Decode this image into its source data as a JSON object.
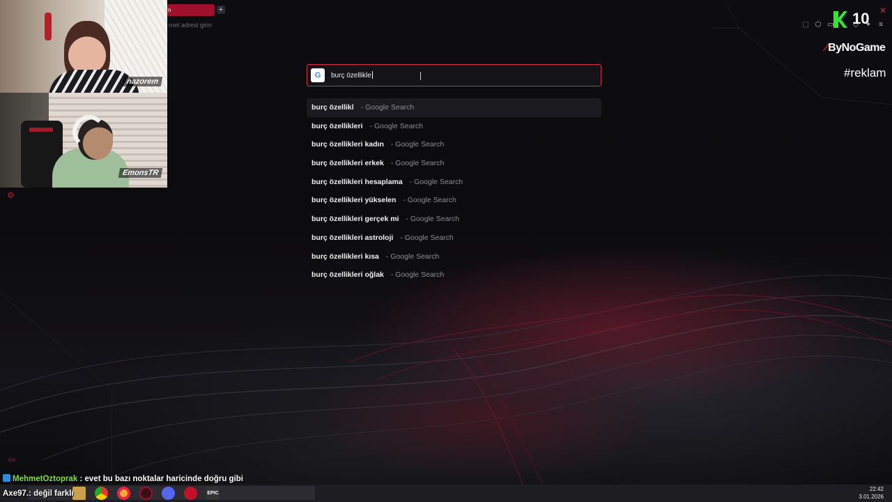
{
  "browser": {
    "active_tab_label": "n",
    "new_tab_label": "+",
    "address_hint": "rnet adresi girin",
    "close_glyph": "✕"
  },
  "webcams": {
    "top_name": "nazorem",
    "bottom_name": "EmonsTR"
  },
  "overlay": {
    "k_count": "10",
    "brand": "ByNoGame",
    "tag": "#reklam"
  },
  "search": {
    "query": "burç özellikle",
    "engine_icon": "G"
  },
  "suggestions": [
    {
      "query": "burç özellikl",
      "source": "- Google Search"
    },
    {
      "query": "burç özellikleri",
      "source": "- Google Search"
    },
    {
      "query": "burç özellikleri kadın",
      "source": "- Google Search"
    },
    {
      "query": "burç özellikleri erkek",
      "source": "- Google Search"
    },
    {
      "query": "burç özellikleri hesaplama",
      "source": "- Google Search"
    },
    {
      "query": "burç özellikleri yükselen",
      "source": "- Google Search"
    },
    {
      "query": "burç özellikleri gerçek mi",
      "source": "- Google Search"
    },
    {
      "query": "burç özellikleri astroloji",
      "source": "- Google Search"
    },
    {
      "query": "burç özellikleri kısa",
      "source": "- Google Search"
    },
    {
      "query": "burç özellikleri oğlak",
      "source": "- Google Search"
    }
  ],
  "chat": {
    "line1_user": "MehmetOztoprak",
    "line1_text": " : evet bu bazı noktalar haricinde doğru gibi",
    "line2_text": "Axe97.: değil farklı"
  },
  "taskbar": {
    "time": "22:42",
    "date": "3.01.2026",
    "epic_label": "EPIC"
  },
  "colors": {
    "accent": "#e0284c",
    "chat_user": "#7fe04a",
    "k_green": "#3ddc3a"
  }
}
